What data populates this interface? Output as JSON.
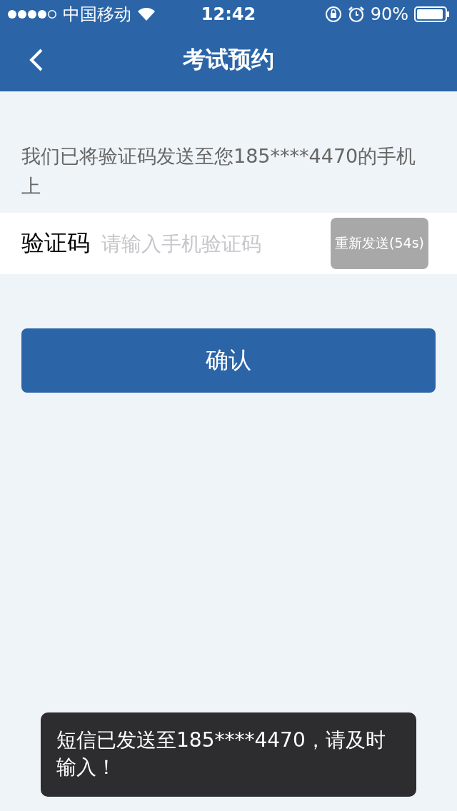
{
  "status_bar": {
    "carrier": "中国移动",
    "time": "12:42",
    "battery": "90%"
  },
  "nav_bar": {
    "title": "考试预约"
  },
  "message": "我们已将验证码发送至您185****4470的手机上",
  "code_field": {
    "label": "验证码",
    "placeholder": "请输入手机验证码",
    "resend_button": {
      "label": "重新发送(54s)",
      "disabled": true
    }
  },
  "confirm_button": {
    "label": "确认"
  },
  "toast": "短信已发送至185****4470，请及时输入！"
}
